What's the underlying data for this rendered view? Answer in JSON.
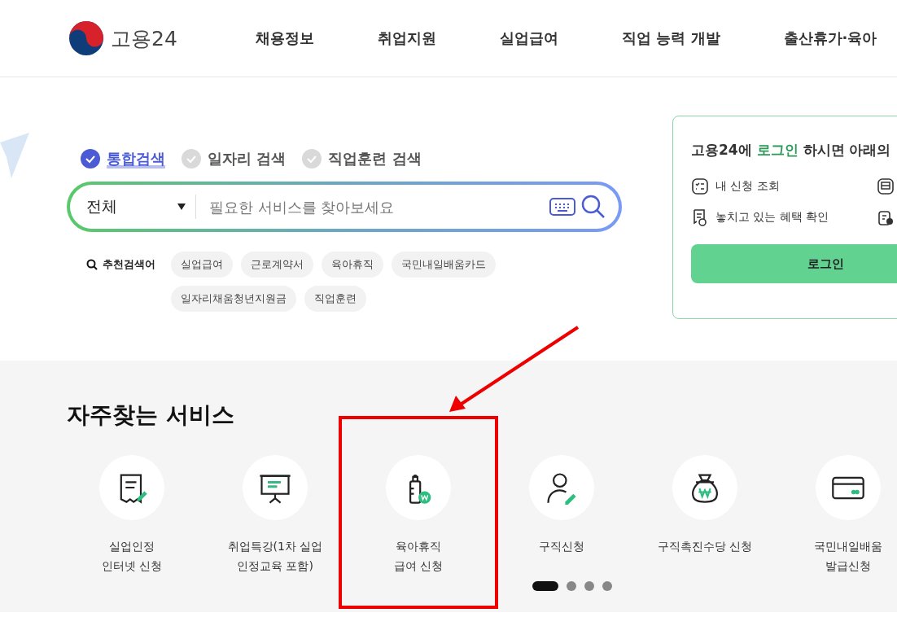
{
  "header": {
    "logo_text": "고용24",
    "nav": [
      {
        "label": "채용정보"
      },
      {
        "label": "취업지원"
      },
      {
        "label": "실업급여"
      },
      {
        "label": "직업 능력 개발"
      },
      {
        "label": "출산휴가·육아"
      }
    ]
  },
  "search": {
    "tabs": [
      {
        "label": "통합검색",
        "selected": true
      },
      {
        "label": "일자리 검색",
        "selected": false
      },
      {
        "label": "직업훈련 검색",
        "selected": false
      }
    ],
    "category": "전체",
    "placeholder": "필요한 서비스를 찾아보세요",
    "recommended_label": "추천검색어",
    "keywords": [
      "실업급여",
      "근로계약서",
      "육아휴직",
      "국민내일배움카드",
      "일자리채움청년지원금",
      "직업훈련"
    ]
  },
  "login_card": {
    "title_before": "고용24에",
    "title_highlight": "로그인",
    "title_after": "하시면 아래의",
    "features": [
      {
        "label": "내 신청 조회"
      },
      {
        "label": "놓치고 있는 혜택 확인"
      }
    ],
    "button": "로그인"
  },
  "services": {
    "title": "자주찾는 서비스",
    "items": [
      {
        "kind": "document",
        "lines": [
          "실업인정",
          "인터넷 신청"
        ],
        "highlighted": false
      },
      {
        "kind": "board",
        "lines": [
          "취업특강(1차 실업",
          "인정교육 포함)"
        ],
        "highlighted": false
      },
      {
        "kind": "bottle",
        "lines": [
          "육아휴직",
          "급여 신청"
        ],
        "highlighted": true
      },
      {
        "kind": "person",
        "lines": [
          "구직신청"
        ],
        "highlighted": false
      },
      {
        "kind": "moneybag",
        "lines": [
          "구직촉진수당 신청"
        ],
        "highlighted": false
      },
      {
        "kind": "card",
        "lines": [
          "국민내일배움",
          "발급신청"
        ],
        "highlighted": false
      }
    ],
    "pager": [
      {
        "selected": true
      },
      {
        "selected": false
      },
      {
        "selected": false
      },
      {
        "selected": false
      }
    ]
  }
}
